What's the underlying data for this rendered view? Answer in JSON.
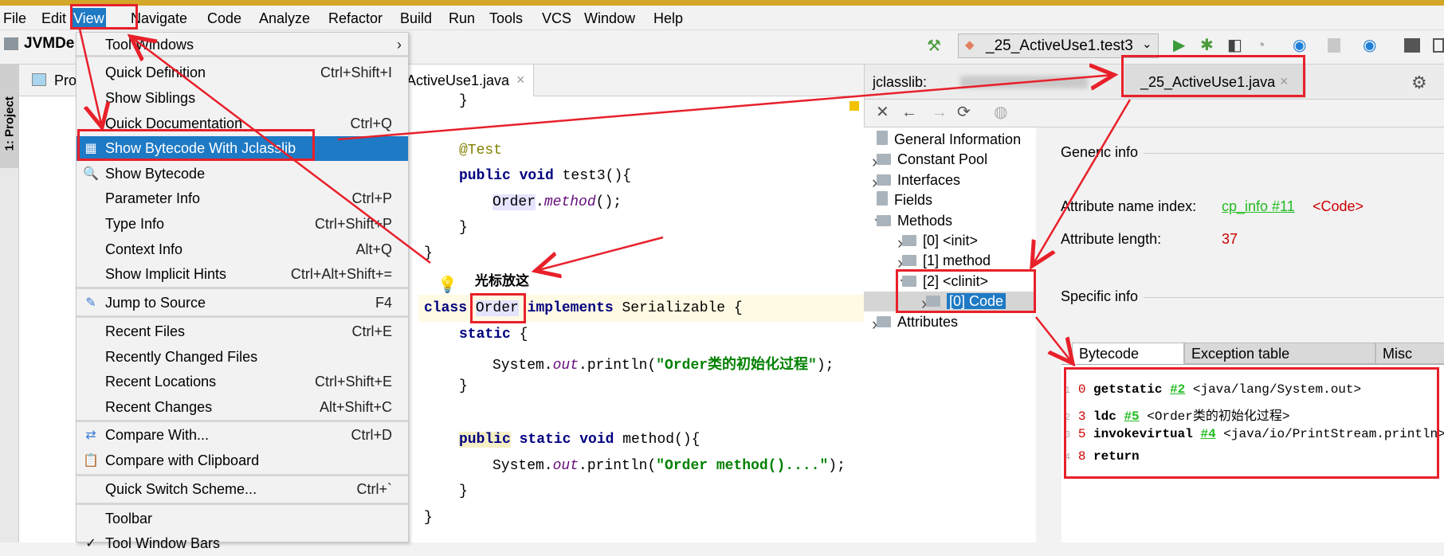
{
  "menubar": {
    "items": [
      "File",
      "Edit",
      "View",
      "Navigate",
      "Code",
      "Analyze",
      "Refactor",
      "Build",
      "Run",
      "Tools",
      "VCS",
      "Window",
      "Help"
    ],
    "active": "View"
  },
  "toolbar": {
    "project": "JVMDe",
    "run_config": "_25_ActiveUse1.test3"
  },
  "left_strip": {
    "label": "1: Project"
  },
  "project_panel": {
    "tab": "Pro"
  },
  "editor": {
    "tab": "ActiveUse1.java"
  },
  "view_menu": {
    "items": [
      {
        "label": "Tool Windows",
        "shortcut": "",
        "submenu": true
      },
      {
        "label": "Quick Definition",
        "shortcut": "Ctrl+Shift+I"
      },
      {
        "label": "Show Siblings",
        "shortcut": ""
      },
      {
        "label": "Quick Documentation",
        "shortcut": "Ctrl+Q"
      },
      {
        "label": "Show Bytecode With Jclasslib",
        "shortcut": "",
        "highlighted": true,
        "icon": "bytecode-icon"
      },
      {
        "label": "Show Bytecode",
        "shortcut": "",
        "icon": "search-bytecode-icon"
      },
      {
        "label": "Parameter Info",
        "shortcut": "Ctrl+P"
      },
      {
        "label": "Type Info",
        "shortcut": "Ctrl+Shift+P"
      },
      {
        "label": "Context Info",
        "shortcut": "Alt+Q"
      },
      {
        "label": "Show Implicit Hints",
        "shortcut": "Ctrl+Alt+Shift+="
      },
      {
        "label": "Jump to Source",
        "shortcut": "F4",
        "icon": "pencil-icon"
      },
      {
        "label": "Recent Files",
        "shortcut": "Ctrl+E"
      },
      {
        "label": "Recently Changed Files",
        "shortcut": ""
      },
      {
        "label": "Recent Locations",
        "shortcut": "Ctrl+Shift+E"
      },
      {
        "label": "Recent Changes",
        "shortcut": "Alt+Shift+C"
      },
      {
        "label": "Compare With...",
        "shortcut": "Ctrl+D",
        "icon": "compare-icon"
      },
      {
        "label": "Compare with Clipboard",
        "shortcut": "",
        "icon": "compare-clipboard-icon"
      },
      {
        "label": "Quick Switch Scheme...",
        "shortcut": "Ctrl+`"
      },
      {
        "label": "Toolbar",
        "shortcut": ""
      },
      {
        "label": "Tool Window Bars",
        "shortcut": "",
        "checked": true
      }
    ]
  },
  "jclasslib": {
    "label": "jclasslib:",
    "tab": "_25_ActiveUse1.java",
    "tree": [
      "General Information",
      "Constant Pool",
      "Interfaces",
      "Fields",
      "Methods",
      "[0] <init>",
      "[1] method",
      "[2] <clinit>",
      "[0] Code",
      "Attributes"
    ],
    "generic_info": "Generic info",
    "attr_name_index_label": "Attribute name index:",
    "attr_name_index_link": "cp_info #11",
    "attr_name_index_value": "<Code>",
    "attr_length_label": "Attribute length:",
    "attr_length_value": "37",
    "specific_info": "Specific info",
    "tabs": [
      "Bytecode",
      "Exception table",
      "Misc"
    ],
    "bytecode": [
      {
        "line": "1",
        "offset": "0",
        "op": "getstatic",
        "ref": "#2",
        "arg": "<java/lang/System.out>"
      },
      {
        "line": "2",
        "offset": "3",
        "op": "ldc",
        "ref": "#5",
        "arg": "<Order类的初始化过程>"
      },
      {
        "line": "3",
        "offset": "5",
        "op": "invokevirtual",
        "ref": "#4",
        "arg": "<java/io/PrintStream.println>"
      },
      {
        "line": "4",
        "offset": "8",
        "op": "return",
        "ref": "",
        "arg": ""
      }
    ]
  },
  "annotation": {
    "label": "光标放这",
    "color": "#e8202a"
  }
}
